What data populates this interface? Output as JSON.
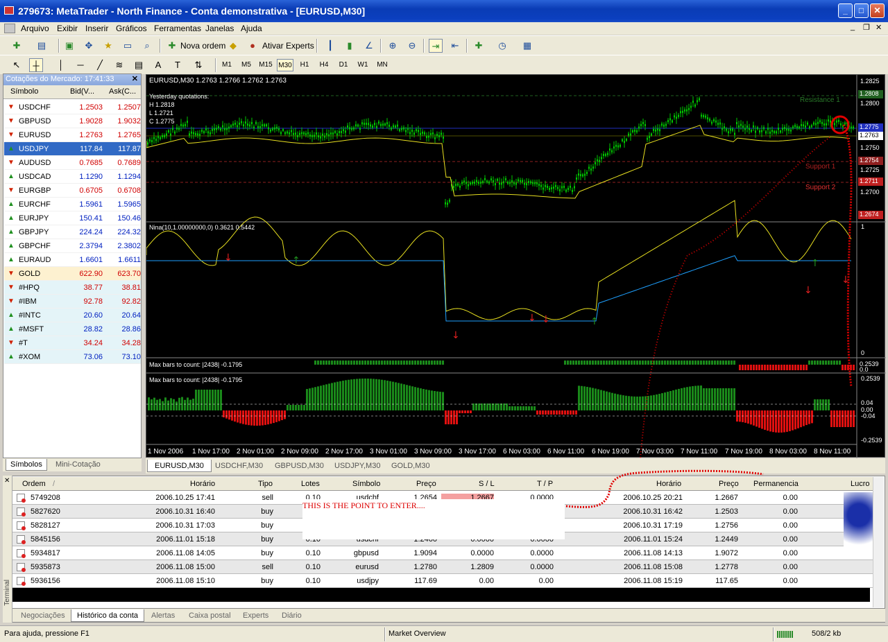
{
  "window": {
    "title": "279673: MetaTrader - North Finance - Conta demonstrativa - [EURUSD,M30]",
    "min": "_",
    "max": "□",
    "close": "✕"
  },
  "menu": [
    "Arquivo",
    "Exibir",
    "Inserir",
    "Gráficos",
    "Ferramentas",
    "Janelas",
    "Ajuda"
  ],
  "toolbar": {
    "new_order": "Nova ordem",
    "experts": "Ativar Experts",
    "timeframes": [
      "M1",
      "M5",
      "M15",
      "M30",
      "H1",
      "H4",
      "D1",
      "W1",
      "MN"
    ],
    "active_tf": "M30"
  },
  "market_watch": {
    "title": "Cotações do Mercado: 17:41:33",
    "col_symbol": "Símbolo",
    "col_bid": "Bid(V...",
    "col_ask": "Ask(C...",
    "rows": [
      {
        "sym": "USDCHF",
        "bid": "1.2503",
        "ask": "1.2507",
        "dir": "down",
        "bg": "#fff"
      },
      {
        "sym": "GBPUSD",
        "bid": "1.9028",
        "ask": "1.9032",
        "dir": "down",
        "bg": "#fff"
      },
      {
        "sym": "EURUSD",
        "bid": "1.2763",
        "ask": "1.2765",
        "dir": "down",
        "bg": "#fff"
      },
      {
        "sym": "USDJPY",
        "bid": "117.84",
        "ask": "117.87",
        "dir": "up",
        "bg": "#316ac5"
      },
      {
        "sym": "AUDUSD",
        "bid": "0.7685",
        "ask": "0.7689",
        "dir": "down",
        "bg": "#fff"
      },
      {
        "sym": "USDCAD",
        "bid": "1.1290",
        "ask": "1.1294",
        "dir": "up",
        "bg": "#fff"
      },
      {
        "sym": "EURGBP",
        "bid": "0.6705",
        "ask": "0.6708",
        "dir": "down",
        "bg": "#fff"
      },
      {
        "sym": "EURCHF",
        "bid": "1.5961",
        "ask": "1.5965",
        "dir": "up",
        "bg": "#fff"
      },
      {
        "sym": "EURJPY",
        "bid": "150.41",
        "ask": "150.46",
        "dir": "up",
        "bg": "#fff"
      },
      {
        "sym": "GBPJPY",
        "bid": "224.24",
        "ask": "224.32",
        "dir": "up",
        "bg": "#fff"
      },
      {
        "sym": "GBPCHF",
        "bid": "2.3794",
        "ask": "2.3802",
        "dir": "up",
        "bg": "#fff"
      },
      {
        "sym": "EURAUD",
        "bid": "1.6601",
        "ask": "1.6611",
        "dir": "up",
        "bg": "#fff"
      },
      {
        "sym": "GOLD",
        "bid": "622.90",
        "ask": "623.70",
        "dir": "down",
        "bg": "#fdf1d0"
      },
      {
        "sym": "#HPQ",
        "bid": "38.77",
        "ask": "38.81",
        "dir": "down",
        "bg": "#e4f4f8"
      },
      {
        "sym": "#IBM",
        "bid": "92.78",
        "ask": "92.82",
        "dir": "down",
        "bg": "#e4f4f8"
      },
      {
        "sym": "#INTC",
        "bid": "20.60",
        "ask": "20.64",
        "dir": "up",
        "bg": "#e4f4f8"
      },
      {
        "sym": "#MSFT",
        "bid": "28.82",
        "ask": "28.86",
        "dir": "up",
        "bg": "#e4f4f8"
      },
      {
        "sym": "#T",
        "bid": "34.24",
        "ask": "34.28",
        "dir": "down",
        "bg": "#e4f4f8"
      },
      {
        "sym": "#XOM",
        "bid": "73.06",
        "ask": "73.10",
        "dir": "up",
        "bg": "#e4f4f8"
      }
    ],
    "tabs": [
      "Símbolos",
      "Mini-Cotação"
    ]
  },
  "chart": {
    "header": "EURUSD,M30  1.2763 1.2766 1.2762 1.2763",
    "yesterday": "Yesterday quotations:",
    "h": "H 1.2818",
    "l": "L 1.2721",
    "c": "C 1.2775",
    "price_labels": [
      "1.2825",
      "1.2800",
      "1.2775",
      "1.2750",
      "1.2725",
      "1.2700",
      "1.2674"
    ],
    "tags": {
      "res": "1.2808",
      "cur": "1.2763",
      "s1": "1.2754",
      "s2": "1.2711",
      "blue": "1.2775",
      "low": "1.2674"
    },
    "lines": {
      "res": "Resistance 1",
      "s1": "Support 1",
      "s2": "Support 2"
    },
    "ind1_title": "Nina(10,1.00000000,0) 0.3621 0.5442",
    "ind1_scale": [
      "1",
      "0"
    ],
    "ind2_title": "Max bars to count: |2438|  -0.1795",
    "ind2_scale": [
      "0.2539",
      "0.0"
    ],
    "ind3_title": "Max bars to count: |2438|  -0.1795",
    "ind3_scale": [
      "0.2539",
      "0.04",
      "0.00",
      "-0.04",
      "-0.2539"
    ],
    "dates": [
      "1 Nov 2006",
      "1 Nov 17:00",
      "2 Nov 01:00",
      "2 Nov 09:00",
      "2 Nov 17:00",
      "3 Nov 01:00",
      "3 Nov 09:00",
      "3 Nov 17:00",
      "6 Nov 03:00",
      "6 Nov 11:00",
      "6 Nov 19:00",
      "7 Nov 03:00",
      "7 Nov 11:00",
      "7 Nov 19:00",
      "8 Nov 03:00",
      "8 Nov 11:00"
    ],
    "tabs": [
      "EURUSD,M30",
      "USDCHF,M30",
      "GBPUSD,M30",
      "USDJPY,M30",
      "GOLD,M30"
    ]
  },
  "terminal": {
    "label": "Terminal",
    "cols": [
      "Ordem",
      "/",
      "Horário",
      "Tipo",
      "Lotes",
      "Símbolo",
      "Preço",
      "S / L",
      "T / P",
      "Horário",
      "Preço",
      "Permanencia",
      "Lucro"
    ],
    "rows": [
      {
        "ordem": "5749208",
        "time": "2006.10.25 17:41",
        "tipo": "sell",
        "lotes": "0.10",
        "sym": "usdchf",
        "price": "1.2654",
        "sl": "1.2667",
        "tp": "0.0000",
        "ctime": "2006.10.25 20:21",
        "cprice": "1.2667",
        "perm": "0.00"
      },
      {
        "ordem": "5827620",
        "time": "2006.10.31 16:40",
        "tipo": "buy",
        "lotes": "",
        "sym": "",
        "price": "",
        "sl": "",
        "tp": "",
        "ctime": "2006.10.31 16:42",
        "cprice": "1.2503",
        "perm": "0.00"
      },
      {
        "ordem": "5828127",
        "time": "2006.10.31 17:03",
        "tipo": "buy",
        "lotes": "",
        "sym": "",
        "price": "",
        "sl": "",
        "tp": "",
        "ctime": "2006.10.31 17:19",
        "cprice": "1.2756",
        "perm": "0.00"
      },
      {
        "ordem": "5845156",
        "time": "2006.11.01 15:18",
        "tipo": "buy",
        "lotes": "0.10",
        "sym": "usdchf",
        "price": "1.2460",
        "sl": "0.0000",
        "tp": "0.0000",
        "ctime": "2006.11.01 15:24",
        "cprice": "1.2449",
        "perm": "0.00"
      },
      {
        "ordem": "5934817",
        "time": "2006.11.08 14:05",
        "tipo": "buy",
        "lotes": "0.10",
        "sym": "gbpusd",
        "price": "1.9094",
        "sl": "0.0000",
        "tp": "0.0000",
        "ctime": "2006.11.08 14:13",
        "cprice": "1.9072",
        "perm": "0.00"
      },
      {
        "ordem": "5935873",
        "time": "2006.11.08 15:00",
        "tipo": "sell",
        "lotes": "0.10",
        "sym": "eurusd",
        "price": "1.2780",
        "sl": "1.2809",
        "tp": "0.0000",
        "ctime": "2006.11.08 15:08",
        "cprice": "1.2778",
        "perm": "0.00"
      },
      {
        "ordem": "5936156",
        "time": "2006.11.08 15:10",
        "tipo": "buy",
        "lotes": "0.10",
        "sym": "usdjpy",
        "price": "117.69",
        "sl": "0.00",
        "tp": "0.00",
        "ctime": "2006.11.08 15:19",
        "cprice": "117.65",
        "perm": "0.00"
      }
    ],
    "note": "THIS IS THE POINT TO ENTER....",
    "tabs": [
      "Negociações",
      "Histórico da conta",
      "Alertas",
      "Caixa postal",
      "Experts",
      "Diário"
    ]
  },
  "status": {
    "help": "Para ajuda, pressione F1",
    "profile": "Market Overview",
    "traffic": "508/2 kb"
  },
  "colors": {
    "bull": "#00c800",
    "ma": "#e8e020",
    "nina_blue": "#1ea0ff",
    "hist_green": "#1a8a1a",
    "hist_red": "#e01010",
    "annot": "#e00000"
  }
}
